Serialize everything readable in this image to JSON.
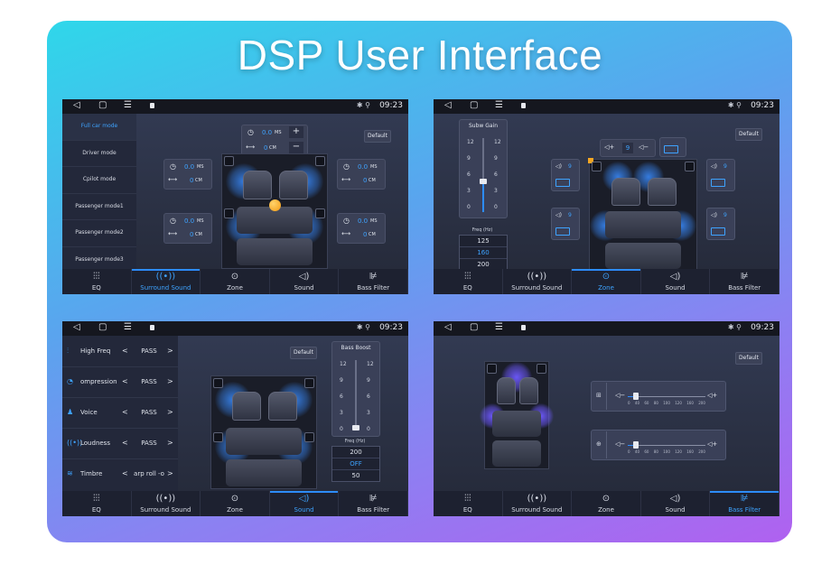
{
  "page_title": "DSP User Interface",
  "status": {
    "time": "09:23",
    "nav_back": "◁",
    "nav_home": "▢",
    "nav_menu": "☰",
    "bt": "✱",
    "loc": "⚲"
  },
  "tabs": [
    {
      "label": "EQ",
      "icon": "equalizer-icon",
      "glyph": "⫶⫶⫶"
    },
    {
      "label": "Surround Sound",
      "icon": "surround-icon",
      "glyph": "((•))"
    },
    {
      "label": "Zone",
      "icon": "zone-icon",
      "glyph": "⊙"
    },
    {
      "label": "Sound",
      "icon": "speaker-icon",
      "glyph": "◁)"
    },
    {
      "label": "Bass Filter",
      "icon": "bass-filter-icon",
      "glyph": "⊯"
    }
  ],
  "default_label": "Default",
  "screen1": {
    "modes": [
      "Full car mode",
      "Driver mode",
      "Cpilot mode",
      "Passenger mode1",
      "Passenger mode2",
      "Passenger mode3"
    ],
    "active_mode": 0,
    "center_delay": {
      "value": "0.0",
      "unit": "MS",
      "dist": "0",
      "dist_unit": "CM",
      "plus": "+",
      "minus": "−"
    },
    "corner_controls": [
      {
        "value": "0.0",
        "unit": "MS",
        "dist": "0",
        "dist_unit": "CM"
      },
      {
        "value": "0.0",
        "unit": "MS",
        "dist": "0",
        "dist_unit": "CM"
      },
      {
        "value": "0.0",
        "unit": "MS",
        "dist": "0",
        "dist_unit": "CM"
      },
      {
        "value": "0.0",
        "unit": "MS",
        "dist": "0",
        "dist_unit": "CM"
      }
    ]
  },
  "screen2": {
    "subw_gain_label": "Subw Gain",
    "ticks": [
      "12",
      "9",
      "6",
      "3",
      "0"
    ],
    "gain_level": 5,
    "freq_label": "Freq (Hz)",
    "freqs": [
      "125",
      "160",
      "200"
    ],
    "freq_selected": 1,
    "top_value": "9",
    "speaker_levels": [
      "9",
      "9",
      "9",
      "9"
    ]
  },
  "screen3": {
    "items": [
      {
        "icon": "high-freq-icon",
        "glyph": "⫶",
        "name": "High Freq",
        "value": "PASS"
      },
      {
        "icon": "compression-icon",
        "glyph": "◔",
        "name": "ompression",
        "value": "PASS"
      },
      {
        "icon": "voice-icon",
        "glyph": "♟",
        "name": "Voice",
        "value": "PASS"
      },
      {
        "icon": "loudness-icon",
        "glyph": "((•))",
        "name": "Loudness",
        "value": "PASS"
      },
      {
        "icon": "timbre-icon",
        "glyph": "≋",
        "name": "Timbre",
        "value": "arp roll -o"
      }
    ],
    "prev": "<",
    "next": ">",
    "bass_boost_label": "Bass Boost",
    "ticks": [
      "12",
      "9",
      "6",
      "3",
      "0"
    ],
    "boost_level": 0,
    "freq_label": "Freq (Hz)",
    "freqs": [
      "200",
      "OFF",
      "50"
    ],
    "freq_selected": 1
  },
  "screen4": {
    "filters": [
      {
        "icon": "filter-grid-icon",
        "level": 0.1
      },
      {
        "icon": "crosshair-icon",
        "level": 0.1
      }
    ],
    "scale": [
      "0",
      "40",
      "60",
      "80",
      "100",
      "120",
      "160",
      "200"
    ]
  },
  "colors": {
    "accent": "#3ea3ff",
    "panel": "#2b3044",
    "orange": "#f5a623"
  }
}
